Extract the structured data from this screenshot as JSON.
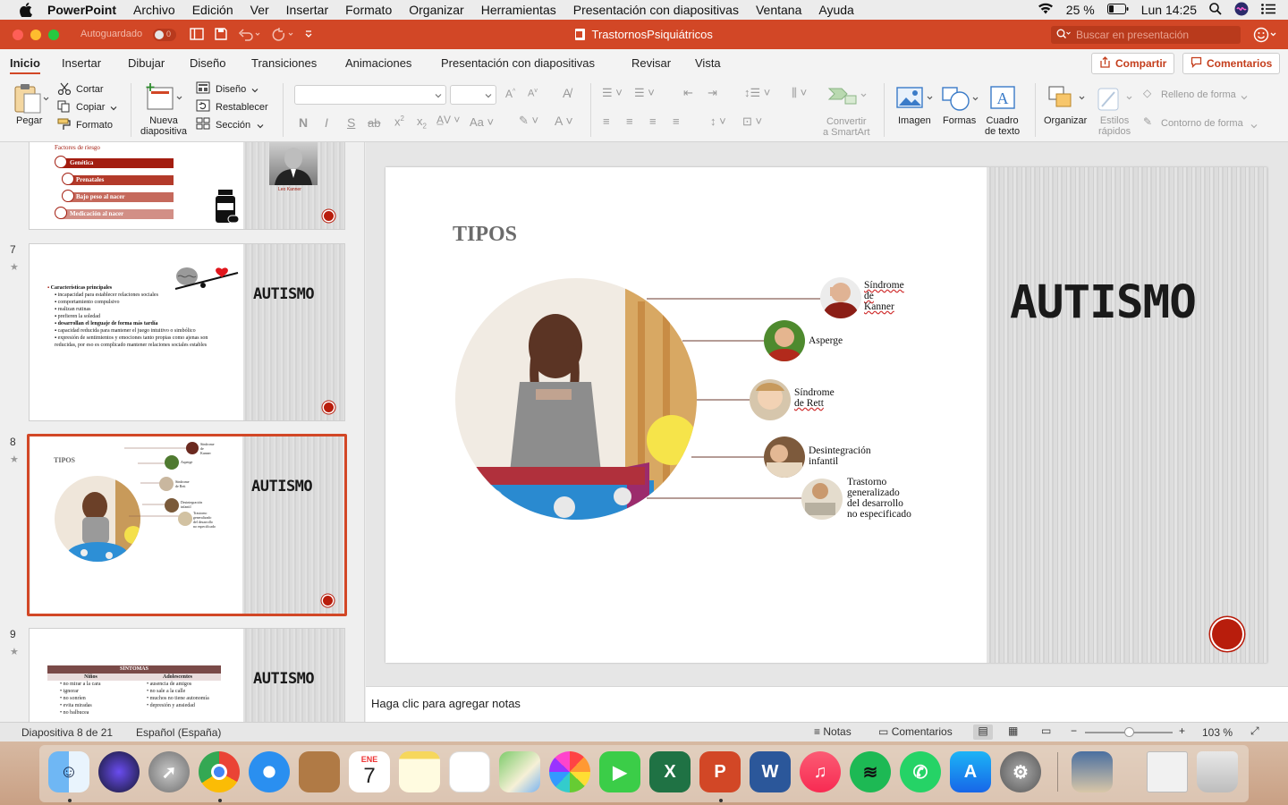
{
  "menubar": {
    "app": "PowerPoint",
    "items": [
      "Archivo",
      "Edición",
      "Ver",
      "Insertar",
      "Formato",
      "Organizar",
      "Herramientas",
      "Presentación con diapositivas",
      "Ventana",
      "Ayuda"
    ],
    "battery": "25 %",
    "clock": "Lun 14:25"
  },
  "titlebar": {
    "autosave": "Autoguardado",
    "toggle": "0",
    "document": "TrastornosPsiquiátricos",
    "search_placeholder": "Buscar en presentación"
  },
  "tabs": {
    "items": [
      "Inicio",
      "Insertar",
      "Dibujar",
      "Diseño",
      "Transiciones",
      "Animaciones",
      "Presentación con diapositivas",
      "Revisar",
      "Vista"
    ],
    "share": "Compartir",
    "comments": "Comentarios"
  },
  "ribbon": {
    "paste": "Pegar",
    "cut": "Cortar",
    "copy": "Copiar",
    "format": "Formato",
    "new_slide_1": "Nueva",
    "new_slide_2": "diapositiva",
    "layout": "Diseño",
    "reset": "Restablecer",
    "section": "Sección",
    "smartart_1": "Convertir",
    "smartart_2": "a SmartArt",
    "image": "Imagen",
    "shapes": "Formas",
    "textbox_1": "Cuadro",
    "textbox_2": "de texto",
    "arrange": "Organizar",
    "styles_1": "Estilos",
    "styles_2": "rápidos",
    "fill": "Relleno de forma",
    "outline": "Contorno de forma",
    "bold": "N",
    "italic": "I",
    "underline": "S",
    "strike": "ab",
    "case": "Aa"
  },
  "thumbs": {
    "s6": {
      "risk": "Factores de riesgo",
      "bars": [
        "Genética",
        "Prenatales",
        "Bajo peso al nacer",
        "Medicación al nacer"
      ],
      "caption": "Leo Kanner"
    },
    "s7": {
      "num": "7",
      "title": "AUTISMO",
      "heading": "Características principales",
      "bullets": [
        "incapacidad para establecer relaciones sociales",
        "comportamiento compulsivo",
        "realizan rutinas",
        "prefieren la soledad",
        "desarrollan el lenguaje de forma más tardía",
        "capacidad reducida para mantener el juego intuitivo o simbólico",
        "expresión de sentimientos y emociones tanto propias como ajenas son reducidas, por eso es complicado mantener relaciones sociales estables"
      ]
    },
    "s8": {
      "num": "8",
      "title": "AUTISMO",
      "label": "TIPOS"
    },
    "s9": {
      "num": "9",
      "title": "AUTISMO",
      "table_title": "SÍNTOMAS",
      "col1": "Niños",
      "col2": "Adolescentes",
      "col1_items": [
        "no mirar a la cara",
        "ignorar",
        "no sonríen",
        "evita miradas",
        "no balbucea"
      ],
      "col2_items": [
        "ausencia de amigos",
        "no sale a la calle",
        "muchos no tiene autonomía",
        "depresión y ansiedad"
      ]
    },
    "star": "★"
  },
  "slide": {
    "heading": "TIPOS",
    "title": "AUTISMO",
    "types": [
      [
        "Síndrome",
        "de",
        "Kanner"
      ],
      [
        "Asperge"
      ],
      [
        "Síndrome",
        "de Rett"
      ],
      [
        "Desintegración",
        "infantil"
      ],
      [
        "Trastorno",
        "generalizado",
        "del desarrollo",
        "no especificado"
      ]
    ]
  },
  "notes": "Haga clic para agregar notas",
  "status": {
    "slide": "Diapositiva 8 de 21",
    "language": "Español (España)",
    "notes": "Notas",
    "comments": "Comentarios",
    "zoom": "103 %"
  },
  "dock": {
    "calendar_month": "ENE",
    "calendar_day": "7"
  },
  "colors": {
    "accent": "#d24726",
    "slide_red": "#b81d0c",
    "bar_dark": "#a31d10",
    "bar_light": "#d28f86"
  }
}
